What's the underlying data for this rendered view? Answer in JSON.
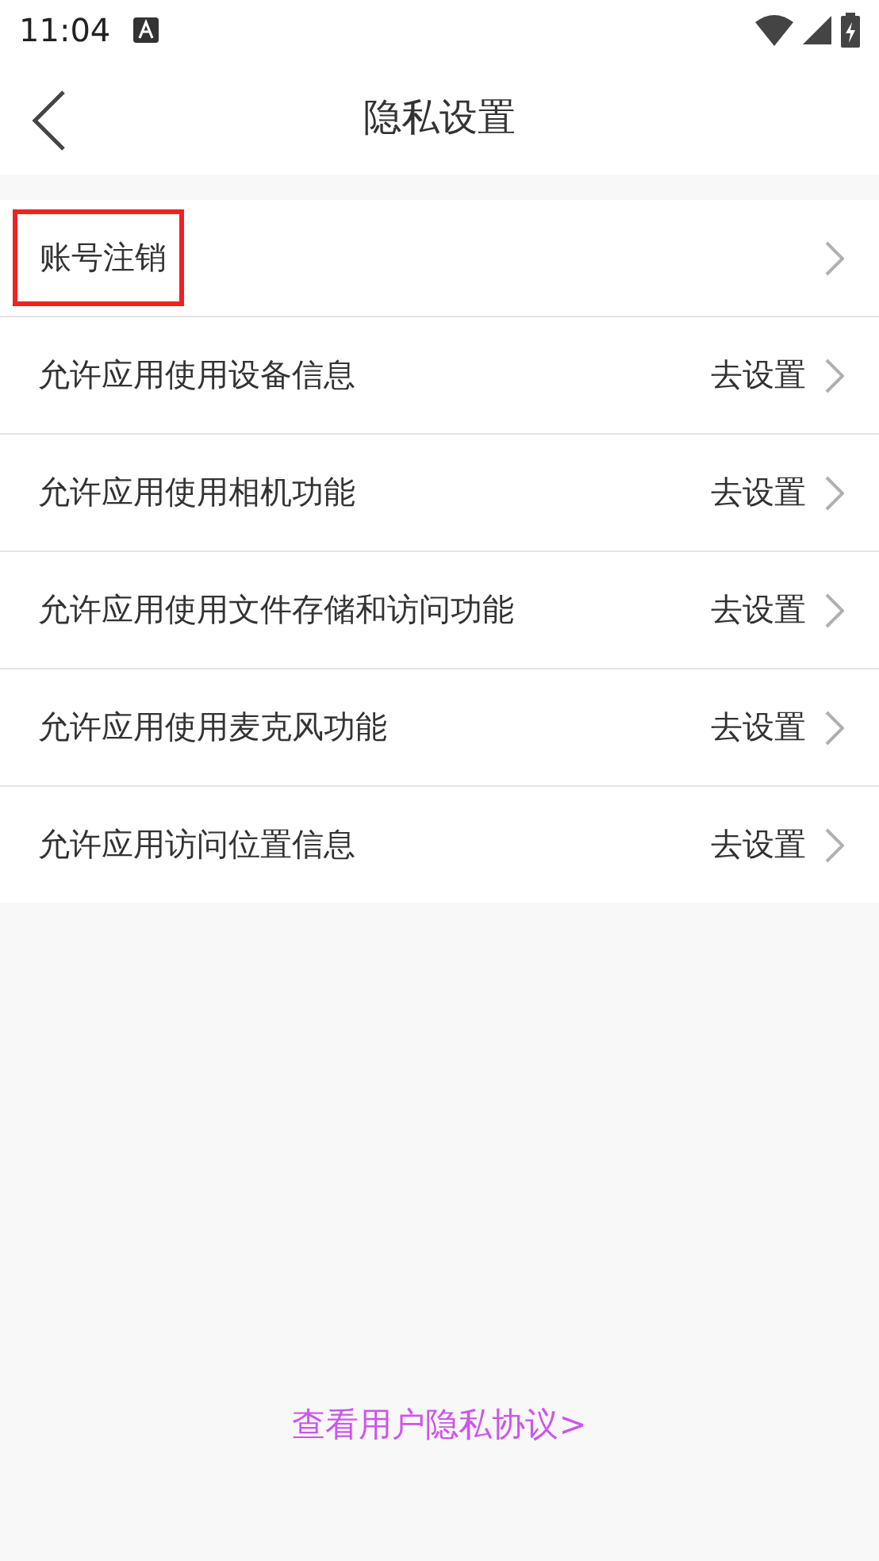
{
  "status_bar": {
    "time": "11:04"
  },
  "header": {
    "title": "隐私设置"
  },
  "rows": [
    {
      "label": "账号注销",
      "highlighted": true
    },
    {
      "label": "允许应用使用设备信息",
      "action": "去设置",
      "highlighted": false
    },
    {
      "label": "允许应用使用相机功能",
      "action": "去设置",
      "highlighted": false
    },
    {
      "label": "允许应用使用文件存储和访问功能",
      "action": "去设置",
      "highlighted": false
    },
    {
      "label": "允许应用使用麦克风功能",
      "action": "去设置",
      "highlighted": false
    },
    {
      "label": "允许应用访问位置信息",
      "action": "去设置",
      "highlighted": false
    }
  ],
  "footer_link": "查看用户隐私协议>"
}
